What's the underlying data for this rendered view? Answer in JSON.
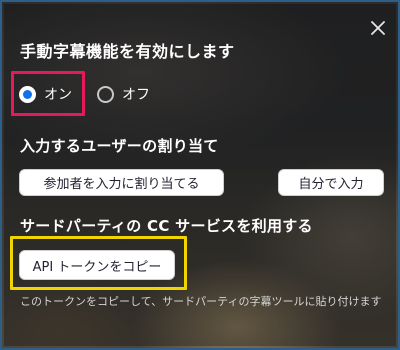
{
  "panel": {
    "close_icon": "close-icon",
    "title": "手動字幕機能を有効にします"
  },
  "toggle": {
    "on_label": "オン",
    "off_label": "オフ",
    "selected": "オン",
    "accent_color": "#0e72ed"
  },
  "assign": {
    "heading": "入力するユーザーの割り当て",
    "assign_button": "参加者を入力に割り当てる",
    "self_button": "自分で入力"
  },
  "third_party": {
    "heading": "サードパーティの CC サービスを利用する",
    "copy_token_button": "API トークンをコピー",
    "note": "このトークンをコピーして、サードパーティの字幕ツールに貼り付けます"
  },
  "highlights": {
    "radio_highlight_color": "#e8195a",
    "api_highlight_color": "#f2d400"
  }
}
